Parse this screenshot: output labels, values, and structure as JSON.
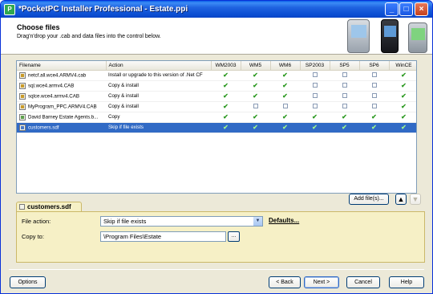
{
  "window": {
    "title": "*PocketPC Installer Professional - Estate.ppi"
  },
  "header": {
    "title": "Choose files",
    "subtitle": "Drag'n'drop your .cab and data files into the control below."
  },
  "grid": {
    "columns": [
      "Filename",
      "Action",
      "WM2003",
      "WM5",
      "WM6",
      "SP2003",
      "SP5",
      "SP6",
      "WinCE"
    ],
    "rows": [
      {
        "icon": "cab-file-icon",
        "filename": "netcf.all.wce4.ARMV4.cab",
        "action": "Install or upgrade to this version of .Net CF",
        "checks": [
          true,
          true,
          true,
          false,
          false,
          false,
          true
        ],
        "selected": false
      },
      {
        "icon": "cab-file-icon",
        "filename": "sql.wce4.armv4.CAB",
        "action": "Copy & install",
        "checks": [
          true,
          true,
          true,
          false,
          false,
          false,
          true
        ],
        "selected": false
      },
      {
        "icon": "cab-file-icon",
        "filename": "sqlce.wce4.armv4.CAB",
        "action": "Copy & install",
        "checks": [
          true,
          true,
          true,
          false,
          false,
          false,
          true
        ],
        "selected": false
      },
      {
        "icon": "cab-file-icon",
        "filename": "MyProgram_PPC.ARMV4.CAB",
        "action": "Copy & install",
        "checks": [
          true,
          false,
          false,
          false,
          false,
          false,
          true
        ],
        "selected": false
      },
      {
        "icon": "document-file-icon",
        "filename": "David Barney Estate Agents.b...",
        "action": "Copy",
        "checks": [
          true,
          true,
          true,
          true,
          true,
          true,
          true
        ],
        "selected": false
      },
      {
        "icon": "database-file-icon",
        "filename": "customers.sdf",
        "action": "Skip if file exists",
        "checks": [
          true,
          true,
          true,
          true,
          true,
          true,
          true
        ],
        "selected": true
      }
    ]
  },
  "toolbar": {
    "add_files": "Add file(s)...",
    "move_up": "▲",
    "move_down": "▼"
  },
  "details": {
    "tab_label": "customers.sdf",
    "file_action_label": "File action:",
    "file_action_value": "Skip if file exists",
    "defaults_link": "Defaults...",
    "copy_to_label": "Copy to:",
    "copy_to_value": "\\Program Files\\Estate",
    "browse_label": "..."
  },
  "footer": {
    "options": "Options",
    "back": "< Back",
    "next": "Next >",
    "cancel": "Cancel",
    "help": "Help"
  }
}
